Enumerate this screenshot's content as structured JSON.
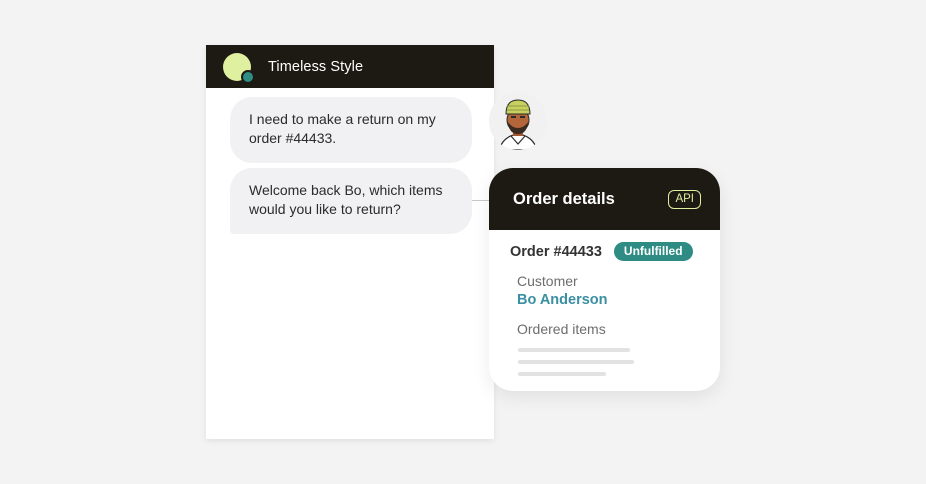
{
  "chat": {
    "brand_name": "Timeless Style",
    "messages": [
      {
        "sender": "customer",
        "text": "I need to make a return on my order #44433."
      },
      {
        "sender": "agent",
        "text": "Welcome back Bo, which items would you like to return?"
      }
    ]
  },
  "order_card": {
    "title": "Order details",
    "api_badge": "API",
    "order_number": "Order #44433",
    "status": "Unfulfilled",
    "customer_label": "Customer",
    "customer_name": "Bo Anderson",
    "items_label": "Ordered items"
  },
  "icons": {
    "brand_logo": "brand-logo-icon",
    "avatar": "customer-avatar"
  },
  "colors": {
    "header_bg": "#1c1a12",
    "accent_lime": "#dff0a0",
    "status_teal": "#2e8c84",
    "link_blue": "#3a8fa2",
    "bubble_bg": "#f1f1f4"
  }
}
